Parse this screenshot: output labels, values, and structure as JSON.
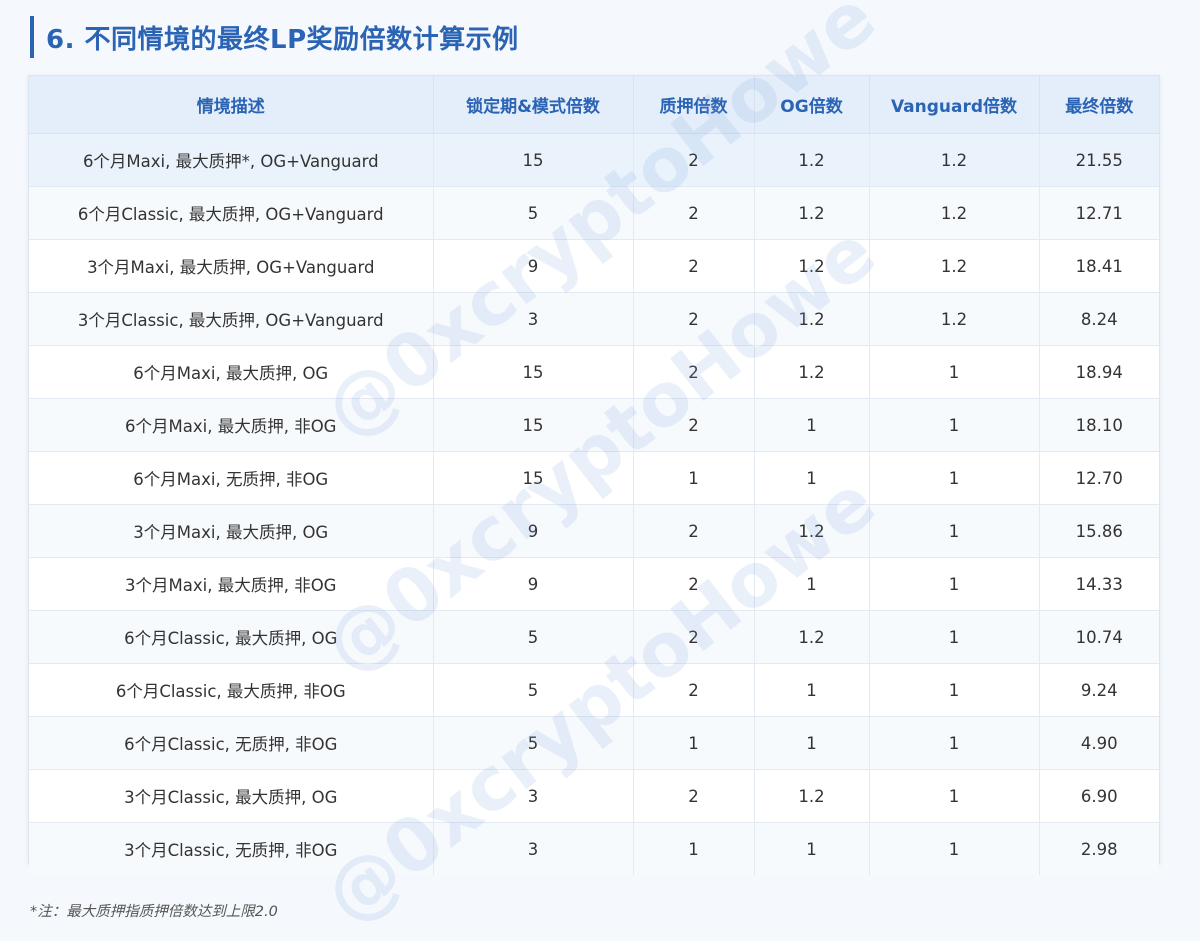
{
  "section": {
    "title": "6. 不同情境的最终LP奖励倍数计算示例"
  },
  "table": {
    "headers": [
      "情境描述",
      "锁定期&模式倍数",
      "质押倍数",
      "OG倍数",
      "Vanguard倍数",
      "最终倍数"
    ],
    "rows": [
      [
        "6个月Maxi, 最大质押*, OG+Vanguard",
        "15",
        "2",
        "1.2",
        "1.2",
        "21.55"
      ],
      [
        "6个月Classic, 最大质押, OG+Vanguard",
        "5",
        "2",
        "1.2",
        "1.2",
        "12.71"
      ],
      [
        "3个月Maxi, 最大质押, OG+Vanguard",
        "9",
        "2",
        "1.2",
        "1.2",
        "18.41"
      ],
      [
        "3个月Classic, 最大质押, OG+Vanguard",
        "3",
        "2",
        "1.2",
        "1.2",
        "8.24"
      ],
      [
        "6个月Maxi, 最大质押, OG",
        "15",
        "2",
        "1.2",
        "1",
        "18.94"
      ],
      [
        "6个月Maxi, 最大质押, 非OG",
        "15",
        "2",
        "1",
        "1",
        "18.10"
      ],
      [
        "6个月Maxi, 无质押, 非OG",
        "15",
        "1",
        "1",
        "1",
        "12.70"
      ],
      [
        "3个月Maxi, 最大质押, OG",
        "9",
        "2",
        "1.2",
        "1",
        "15.86"
      ],
      [
        "3个月Maxi, 最大质押, 非OG",
        "9",
        "2",
        "1",
        "1",
        "14.33"
      ],
      [
        "6个月Classic, 最大质押, OG",
        "5",
        "2",
        "1.2",
        "1",
        "10.74"
      ],
      [
        "6个月Classic, 最大质押, 非OG",
        "5",
        "2",
        "1",
        "1",
        "9.24"
      ],
      [
        "6个月Classic, 无质押, 非OG",
        "5",
        "1",
        "1",
        "1",
        "4.90"
      ],
      [
        "3个月Classic, 最大质押, OG",
        "3",
        "2",
        "1.2",
        "1",
        "6.90"
      ],
      [
        "3个月Classic, 无质押, 非OG",
        "3",
        "1",
        "1",
        "1",
        "2.98"
      ]
    ]
  },
  "watermark": {
    "text": "@0xcryptoHowe"
  },
  "footnote": {
    "text": "*注：最大质押指质押倍数达到上限2.0"
  },
  "colors": {
    "accent": "#2b64b4",
    "header_bg": "#e4eefa",
    "page_bg": "#f5f9fd"
  }
}
